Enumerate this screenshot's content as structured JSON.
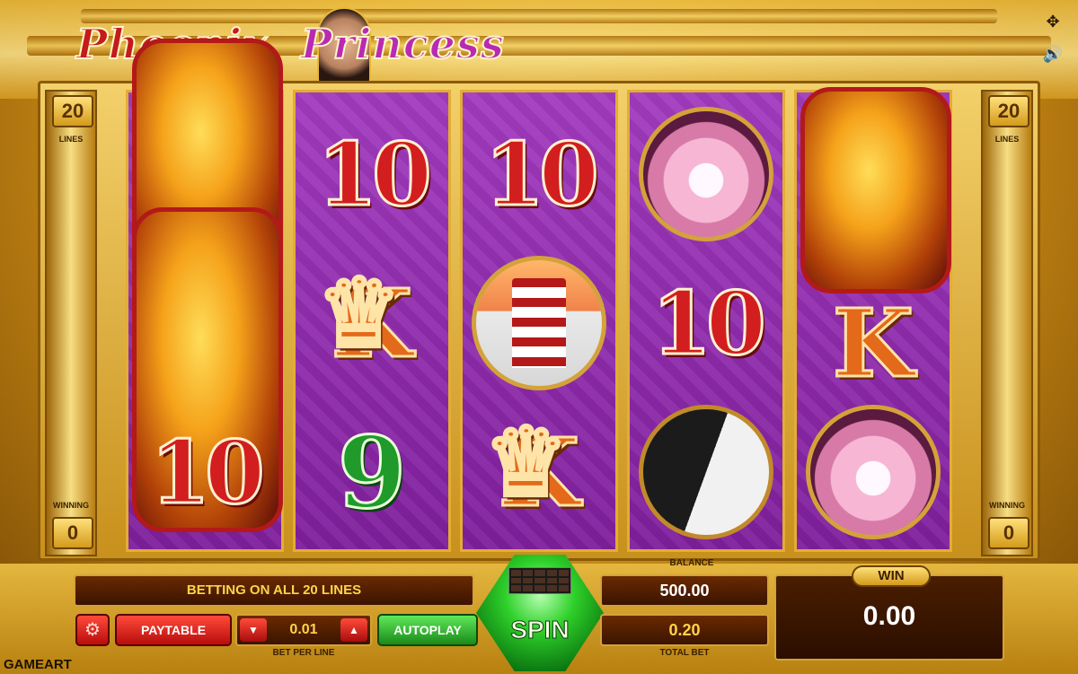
{
  "game": {
    "title_word1": "Phoenix",
    "title_word2": "Princess",
    "provider_logo": "GAMEART"
  },
  "top_icons": [
    "fullscreen-icon",
    "sound-icon"
  ],
  "side_panels": {
    "lines_value": "20",
    "lines_label": "LINES",
    "winning_label": "WINNING",
    "winning_value": "0"
  },
  "reels": [
    [
      "phoenix",
      "phoenix",
      "10"
    ],
    [
      "10",
      "K",
      "9"
    ],
    [
      "10",
      "pagoda",
      "K"
    ],
    [
      "lotus",
      "10",
      "yin-yang"
    ],
    [
      "phoenix",
      "K",
      "lotus"
    ]
  ],
  "symbol_text": {
    "ten": "10",
    "king": "K",
    "nine": "9"
  },
  "controls": {
    "info_text": "BETTING ON ALL 20 LINES",
    "settings_icon": "gear-icon",
    "paytable_label": "PAYTABLE",
    "bet_per_line_value": "0.01",
    "bet_per_line_label": "BET PER LINE",
    "bet_down_icon": "triangle-down-icon",
    "bet_up_icon": "triangle-up-icon",
    "autoplay_label": "AUTOPLAY",
    "spin_label": "SPIN",
    "balance_label": "BALANCE",
    "balance_value": "500.00",
    "total_bet_value": "0.20",
    "total_bet_label": "TOTAL BET",
    "win_label": "WIN",
    "win_value": "0.00"
  },
  "colors": {
    "reel_purple": "#8f2bb0",
    "gold": "#e3ad33",
    "spin_green": "#2fd02a",
    "button_red": "#d21e1e"
  }
}
